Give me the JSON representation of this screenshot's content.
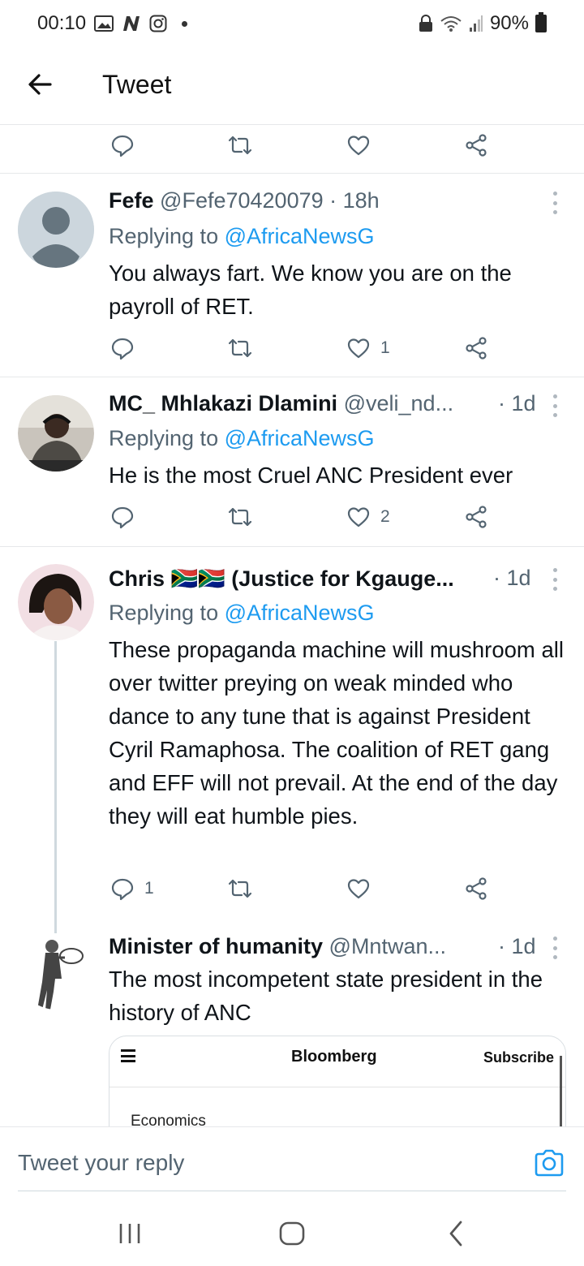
{
  "status_bar": {
    "time": "00:10",
    "battery": "90%",
    "icons": [
      "gallery-icon",
      "n-icon",
      "instagram-icon",
      "lock-icon",
      "wifi-icon",
      "signal-icon",
      "battery-icon"
    ]
  },
  "header": {
    "title": "Tweet",
    "back_icon": "arrow-left-icon"
  },
  "tweets": [
    {
      "name": "Fefe",
      "handle": "@Fefe70420079",
      "time": "· 18h",
      "replying_prefix": "Replying to",
      "replying_to": "@AfricaNewsG",
      "text": "You always fart. We know you are on the payroll of RET.",
      "reply_count": "",
      "retweet_count": "",
      "like_count": "1"
    },
    {
      "name": "MC_ Mhlakazi Dlamini",
      "handle": "@veli_nd...",
      "time": "· 1d",
      "replying_prefix": "Replying to",
      "replying_to": "@AfricaNewsG",
      "text": "He is the most Cruel ANC President ever",
      "reply_count": "",
      "retweet_count": "",
      "like_count": "2"
    },
    {
      "name": "Chris 🇿🇦🇿🇦 (Justice for Kgauge...",
      "handle": "",
      "time": "· 1d",
      "replying_prefix": "Replying to",
      "replying_to": "@AfricaNewsG",
      "text": "These propaganda machine will mushroom all over twitter preying on weak minded who dance to any tune that is against President Cyril Ramaphosa. The coalition of RET gang and EFF will not prevail. At the end of the day they will eat humble pies.",
      "reply_count": "1",
      "retweet_count": "",
      "like_count": ""
    },
    {
      "name": "Minister of humanity",
      "handle": "@Mntwan...",
      "time": "· 1d",
      "text": "The most incompetent state president in the history of ANC"
    }
  ],
  "card": {
    "brand": "Bloomberg",
    "subscribe": "Subscribe",
    "category": "Economics"
  },
  "reply_bar": {
    "placeholder": "Tweet your reply"
  },
  "colors": {
    "link": "#1d9bf0",
    "secondary": "#536471",
    "text": "#0f1419"
  }
}
